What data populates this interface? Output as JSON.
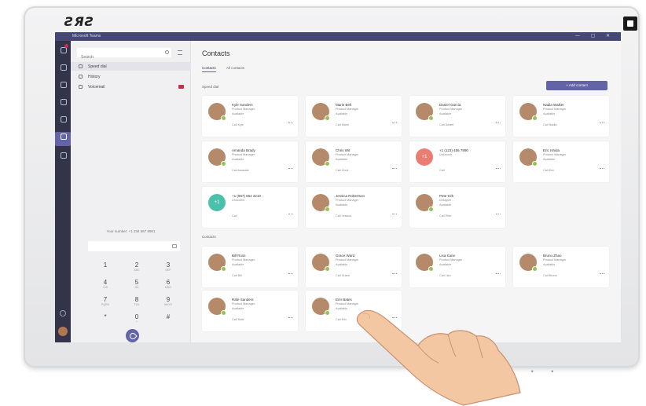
{
  "brand": {
    "logo_text": "ƧЯƧ"
  },
  "app": {
    "title": "Microsoft Teams",
    "window_controls": "— ▢ ✕"
  },
  "left_pane": {
    "search_placeholder": "Search",
    "nav": [
      {
        "label": "Speed dial",
        "active": true,
        "badge": false
      },
      {
        "label": "History",
        "active": false,
        "badge": false
      },
      {
        "label": "Voicemail",
        "active": false,
        "badge": true
      }
    ],
    "caller_id": "Your number: +1 234 567 8901",
    "keypad": [
      {
        "digit": "1",
        "letters": ""
      },
      {
        "digit": "2",
        "letters": "ABC"
      },
      {
        "digit": "3",
        "letters": "DEF"
      },
      {
        "digit": "4",
        "letters": "GHI"
      },
      {
        "digit": "5",
        "letters": "JKL"
      },
      {
        "digit": "6",
        "letters": "MNO"
      },
      {
        "digit": "7",
        "letters": "PQRS"
      },
      {
        "digit": "8",
        "letters": "TUV"
      },
      {
        "digit": "9",
        "letters": "WXYZ"
      },
      {
        "digit": "*",
        "letters": ""
      },
      {
        "digit": "0",
        "letters": "+"
      },
      {
        "digit": "#",
        "letters": ""
      }
    ]
  },
  "main": {
    "title": "Contacts",
    "tabs": [
      "Contacts",
      "All contacts"
    ],
    "add_button": "+ Add contact",
    "section_speed_dial": "Speed dial",
    "section_contacts": "Contacts",
    "speed_dial_cards": [
      {
        "name": "Kyle Sanders",
        "role": "Product Manager",
        "status": "Available",
        "action": "Call Kyle",
        "avatar": "skin1"
      },
      {
        "name": "Marie Bell",
        "role": "Product Manager",
        "status": "Available",
        "action": "Call Marie",
        "avatar": "skin2"
      },
      {
        "name": "Daniel Garcia",
        "role": "Product Manager",
        "status": "Available",
        "action": "Call Daniel",
        "avatar": "skin3"
      },
      {
        "name": "Nadia Walker",
        "role": "Product Manager",
        "status": "Available",
        "action": "Call Nadia",
        "avatar": "skin4"
      },
      {
        "name": "Amanda Brady",
        "role": "Product Manager",
        "status": "Available",
        "action": "Call Amanda",
        "avatar": "skin1"
      },
      {
        "name": "Chris Wit",
        "role": "Product Manager",
        "status": "Available",
        "action": "Call Chris",
        "avatar": "skin5"
      },
      {
        "name": "+1 (123) 456 7890",
        "role": "Unknown",
        "status": "",
        "action": "Call",
        "avatar": "initials",
        "initials": "+1"
      },
      {
        "name": "Eric Ishida",
        "role": "Product Manager",
        "status": "Available",
        "action": "Call Eric",
        "avatar": "skin6"
      },
      {
        "name": "+1 (987) 654 3210",
        "role": "Unknown",
        "status": "",
        "action": "Call",
        "avatar": "initials-teal",
        "initials": "+1"
      },
      {
        "name": "Jessica Robertson",
        "role": "Product Manager",
        "status": "Available",
        "action": "Call Jessica",
        "avatar": "skin2"
      },
      {
        "name": "Pete Kirk",
        "role": "Designer",
        "status": "Available",
        "action": "Call Pete",
        "avatar": "skin3"
      }
    ],
    "contact_cards": [
      {
        "name": "Bill Ross",
        "role": "Product Manager",
        "status": "Available",
        "action": "Call Bill",
        "avatar": "skin4"
      },
      {
        "name": "Grace Ward",
        "role": "Product Manager",
        "status": "Available",
        "action": "Call Grace",
        "avatar": "skin2"
      },
      {
        "name": "Lisa Kane",
        "role": "Product Manager",
        "status": "Available",
        "action": "Call Lisa",
        "avatar": "skin1"
      },
      {
        "name": "Bruno Zhao",
        "role": "Product Manager",
        "status": "Available",
        "action": "Call Bruno",
        "avatar": "skin5"
      },
      {
        "name": "Rafe Sanders",
        "role": "Product Manager",
        "status": "Available",
        "action": "Call Rafe",
        "avatar": "skin6"
      },
      {
        "name": "Erin Bates",
        "role": "Product Manager",
        "status": "Available",
        "action": "Call Erin",
        "avatar": "skin3"
      }
    ]
  },
  "colors": {
    "accent": "#6264a7",
    "rail": "#33344a",
    "titlebar": "#464775",
    "presence": "#92c353",
    "badge": "#c4314b"
  }
}
